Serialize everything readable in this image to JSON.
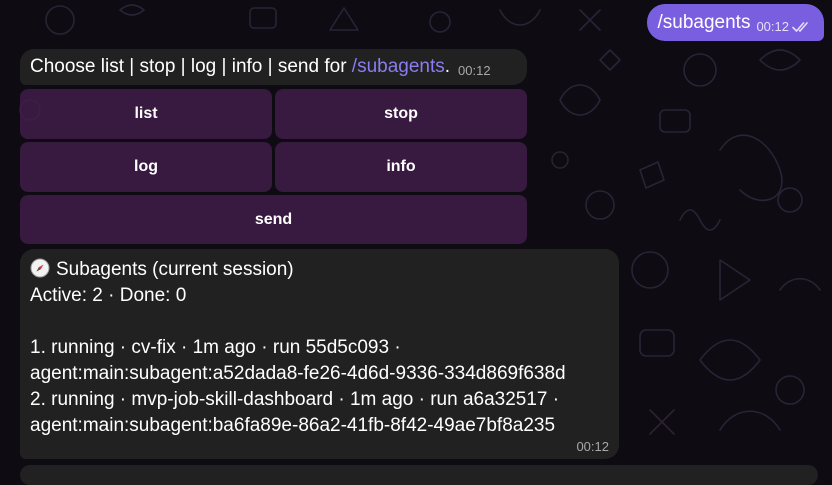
{
  "outgoing": {
    "text": "/subagents",
    "time": "00:12"
  },
  "prompt": {
    "prefix": "Choose list | stop | log | info | send for ",
    "command": "/subagents",
    "suffix": ".",
    "time": "00:12"
  },
  "keyboard": {
    "list": "list",
    "stop": "stop",
    "log": "log",
    "info": "info",
    "send": "send"
  },
  "subagents": {
    "title": "Subagents (current session)",
    "summary": "Active: 2 · Done: 0",
    "row1_a": "1. running · cv-fix · 1m ago · run 55d5c093 ·",
    "row1_b": "agent:main:subagent:a52dada8-fe26-4d6d-9336-334d869f638d",
    "row2_a": "2. running · mvp-job-skill-dashboard · 1m ago · run a6a32517 ·",
    "row2_b": "agent:main:subagent:ba6fa89e-86a2-41fb-8f42-49ae7bf8a235",
    "time": "00:12"
  },
  "colors": {
    "background": "#0e0b12",
    "outgoing_bubble": "#7a5ee0",
    "incoming_bubble": "#212121",
    "keyboard_button": "#421c4a",
    "link": "#8b7cf0"
  },
  "icons": {
    "read_status": "double-check-icon",
    "subagents_title": "compass-icon"
  }
}
